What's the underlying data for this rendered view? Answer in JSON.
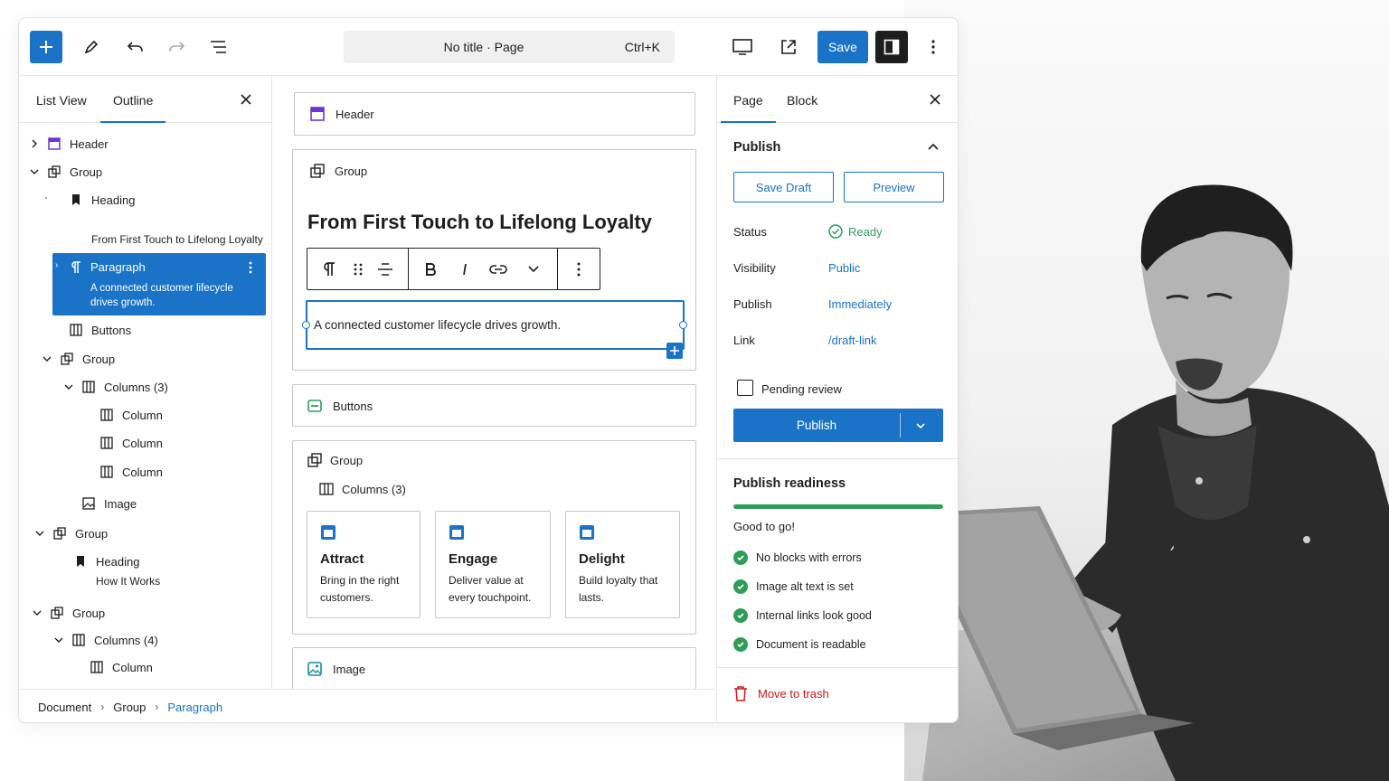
{
  "topbar": {
    "title": "No title · Page",
    "shortcut": "Ctrl+K",
    "save_label": "Save"
  },
  "left_panel": {
    "tabs": [
      "List View",
      "Outline"
    ],
    "tree": [
      {
        "label": "Header"
      },
      {
        "label": "Group"
      },
      {
        "label": "Heading",
        "sub": "From First Touch to Lifelong Loyalty"
      },
      {
        "label": "Paragraph",
        "sub": "A connected customer lifecycle drives growth.",
        "selected": true
      },
      {
        "label": "Buttons"
      },
      {
        "label": "Group"
      },
      {
        "label": "Columns (3)"
      },
      {
        "label": "Column"
      },
      {
        "label": "Column"
      },
      {
        "label": "Column"
      },
      {
        "label": "Image"
      },
      {
        "label": "Group"
      },
      {
        "label": "Heading",
        "sub": "How It Works"
      },
      {
        "label": "Group"
      },
      {
        "label": "Columns (4)"
      },
      {
        "label": "Column"
      }
    ]
  },
  "breadcrumb": [
    "Document",
    "Group",
    "Paragraph"
  ],
  "canvas": {
    "header_block": "Header",
    "group_label": "Group",
    "heading": "From First Touch to Lifelong Loyalty",
    "paragraph": "A connected customer lifecycle drives growth.",
    "buttons_block": "Buttons",
    "group2_label": "Group",
    "columns_label": "Columns (3)",
    "cards": [
      {
        "title": "Attract",
        "desc": "Bring in the right customers."
      },
      {
        "title": "Engage",
        "desc": "Deliver value at every touchpoint."
      },
      {
        "title": "Delight",
        "desc": "Build loyalty that lasts."
      }
    ],
    "image_block": "Image"
  },
  "right_panel": {
    "tabs": [
      "Page",
      "Block"
    ],
    "publish_title": "Publish",
    "save_draft": "Save Draft",
    "preview": "Preview",
    "status_label": "Status",
    "status_value": "Ready",
    "visibility_label": "Visibility",
    "visibility_value": "Public",
    "publish_label": "Publish",
    "publish_value": "Immediately",
    "link_label": "Link",
    "link_value": "/draft-link",
    "pending_review": "Pending review",
    "publish_button": "Publish",
    "readiness_title": "Publish readiness",
    "readiness_progress": 1.0,
    "readiness_status": "Good to go!",
    "checks": [
      "No blocks with errors",
      "Image alt text is set",
      "Internal links look good",
      "Document is readable"
    ],
    "trash": "Move to trash"
  },
  "colors": {
    "accent": "#1a73c6",
    "success": "#2e9d5a",
    "danger": "#cc1818"
  }
}
